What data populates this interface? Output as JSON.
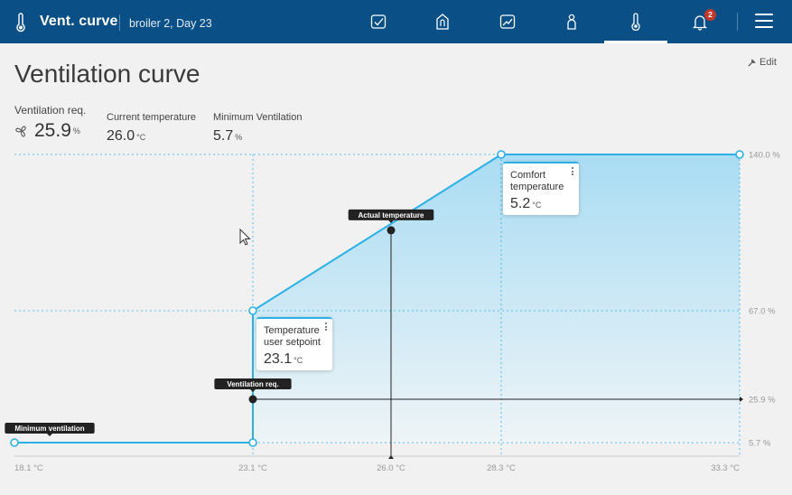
{
  "header": {
    "title": "Vent. curve",
    "subtitle": "broiler 2, Day 23",
    "nav": [
      {
        "icon": "checkbox-icon"
      },
      {
        "icon": "silo-icon"
      },
      {
        "icon": "trend-chart-icon"
      },
      {
        "icon": "person-icon"
      },
      {
        "icon": "thermometer-icon",
        "active": true
      },
      {
        "icon": "bell-icon",
        "badge": "2"
      }
    ],
    "menu_icon": "hamburger-menu-icon"
  },
  "page": {
    "title": "Ventilation curve",
    "edit_label": "Edit"
  },
  "stats": {
    "ventilation_req": {
      "label": "Ventilation req.",
      "value": "25.9",
      "unit": "%",
      "icon": "fan-icon"
    },
    "current_temp": {
      "label": "Current temperature",
      "value": "26.0",
      "unit": "°C"
    },
    "min_ventilation": {
      "label": "Minimum Ventilation",
      "value": "5.7",
      "unit": "%"
    }
  },
  "cards": {
    "comfort": {
      "label_line1": "Comfort",
      "label_line2": "temperature",
      "value": "5.2",
      "unit": "°C"
    },
    "setpoint": {
      "label_line1": "Temperature",
      "label_line2": "user setpoint",
      "value": "23.1",
      "unit": "°C"
    }
  },
  "colors": {
    "header": "#0a4f86",
    "curve": "#2bb0e6",
    "fill_top": "#a9dcf3"
  },
  "chart_data": {
    "type": "area",
    "x_ticks": [
      "18.1 °C",
      "23.1 °C",
      "26.0 °C",
      "28.3 °C",
      "33.3 °C"
    ],
    "y_ticks": [
      "140.0 %",
      "67.0 %",
      "25.9 %",
      "5.7 %"
    ],
    "curve": [
      {
        "x": 18.1,
        "y": 5.7
      },
      {
        "x": 23.1,
        "y": 5.7
      },
      {
        "x": 23.1,
        "y": 67.0
      },
      {
        "x": 28.3,
        "y": 140.0
      },
      {
        "x": 33.3,
        "y": 140.0
      }
    ],
    "actual_temperature": {
      "x": 26.0,
      "y": 104.6,
      "label": "Actual temperature"
    },
    "ventilation_req_marker": {
      "x": 23.1,
      "y": 25.9,
      "label": "Ventilation req."
    },
    "min_ventilation_marker": {
      "x": 18.1,
      "y": 5.7,
      "label": "Minimum ventilation"
    },
    "xlim": [
      18.1,
      33.3
    ],
    "ylim": [
      5.7,
      140.0
    ]
  }
}
